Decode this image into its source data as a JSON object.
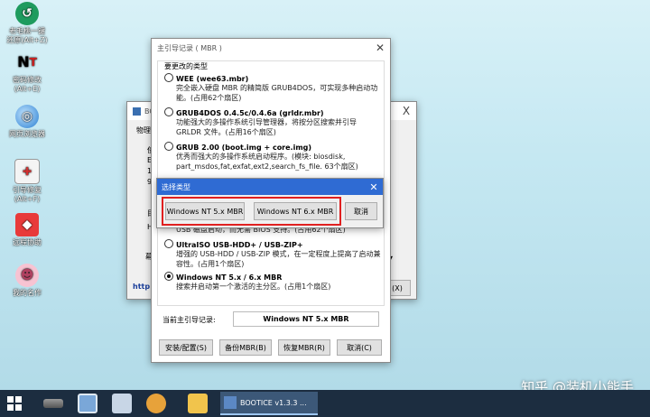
{
  "desktop_icons": [
    {
      "label": "老毛桃一键\n还原(Alt+Z)",
      "icon": "restore-icon",
      "color": "#1e9b5e"
    },
    {
      "label": "密码修改\n(Alt+E)",
      "icon": "ntpwd-icon",
      "color": "#000000"
    },
    {
      "label": "网页浏览器",
      "icon": "browser-icon",
      "color": "#4a90d9"
    },
    {
      "label": "引导修复\n(Alt+F)",
      "icon": "bootfix-icon",
      "color": "#d03030"
    },
    {
      "label": "远程协助",
      "icon": "remote-icon",
      "color": "#e83a3a"
    },
    {
      "label": "我的名作",
      "icon": "mascot-icon",
      "color": "#f29bb4"
    }
  ],
  "back_window": {
    "title": "BOOTICE",
    "tab_prefix": "物理",
    "labels": [
      "目",
      "使",
      "E",
      "1",
      "9",
      "幕",
      "H"
    ],
    "link": "http:",
    "close_btn": "(X)",
    "btn_label": "X"
  },
  "mbr_dialog": {
    "title": "主引导记录 ( MBR )",
    "group_label": "要更改的类型",
    "options": [
      {
        "name": "WEE (wee63.mbr)",
        "desc": "完全嵌入硬盘 MBR 的精简版 GRUB4DOS，可实现多种启动功能。(占用62个扇区)",
        "selected": false
      },
      {
        "name": "GRUB4DOS 0.4.5c/0.4.6a (grldr.mbr)",
        "desc": "功能强大的多操作系统引导管理器，将按分区搜索并引导 GRLDR 文件。(占用16个扇区)",
        "selected": false
      },
      {
        "name": "GRUB 2.00 (boot.img + core.img)",
        "desc": "优秀而强大的多操作系统启动程序。(模块: biosdisk, part_msdos,fat,exfat,ext2,search_fs_file. 63个扇区)",
        "selected": false
      },
      {
        "name": "",
        "desc": "USB 磁盘启动，而无需 BIOS 支持。(占用62个扇区)",
        "selected": false
      },
      {
        "name": "UltraISO USB-HDD+ / USB-ZIP+",
        "desc": "增强的 USB-HDD / USB-ZIP 模式，在一定程度上提高了启动兼容性。(占用1个扇区)",
        "selected": false
      },
      {
        "name": "Windows NT 5.x / 6.x MBR",
        "desc": "搜索并启动第一个激活的主分区。(占用1个扇区)",
        "selected": true
      }
    ],
    "current_label": "当前主引导记录:",
    "current_value": "Windows NT 5.x MBR",
    "buttons": [
      "安装/配置(S)",
      "备份MBR(B)",
      "恢复MBR(R)",
      "取消(C)"
    ]
  },
  "select_dialog": {
    "title": "选择类型",
    "buttons": [
      "Windows NT 5.x MBR",
      "Windows NT 6.x MBR",
      "取消"
    ],
    "highlight_color": "#e02020"
  },
  "taskbar": {
    "app_label": "BOOTICE v1.3.3 ...",
    "watermark": "知乎 @装机小能手"
  }
}
